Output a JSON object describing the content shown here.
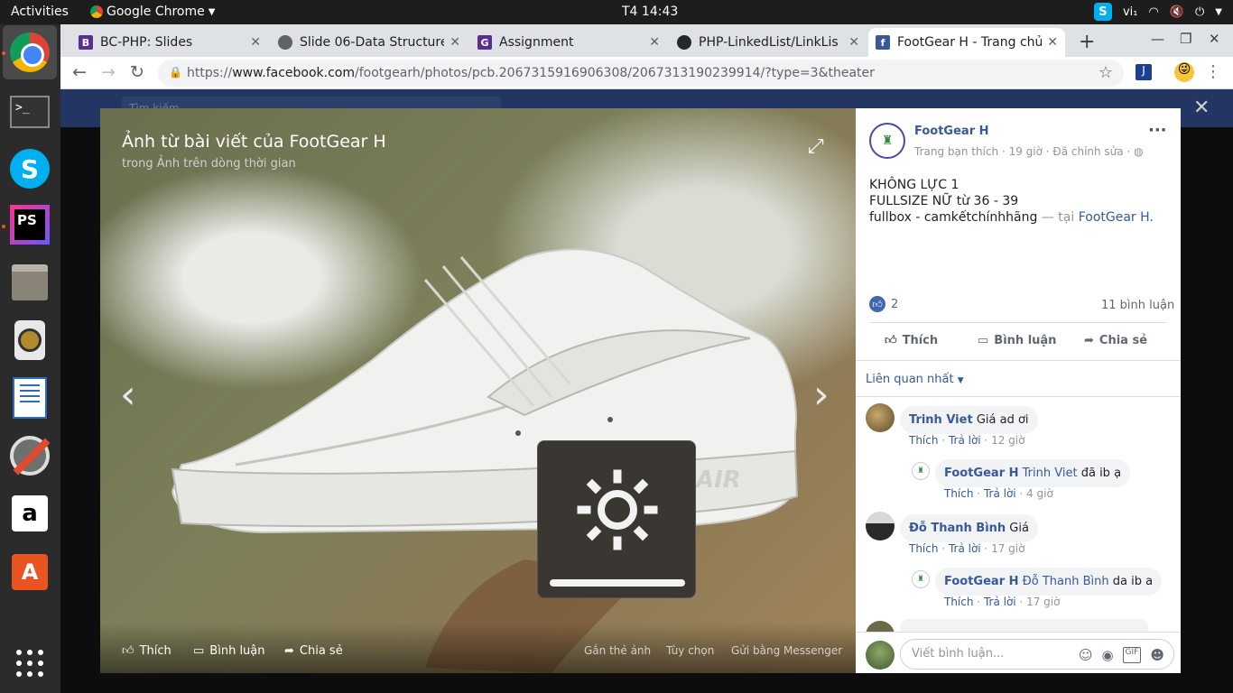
{
  "topbar": {
    "activities": "Activities",
    "app_name": "Google Chrome",
    "clock": "T4 14:43",
    "keyboard": "vi₁"
  },
  "browser": {
    "tabs": [
      {
        "title": "BC-PHP: Slides",
        "favicon_color": "#5b2d8e",
        "icon": "slides-icon"
      },
      {
        "title": "Slide 06-Data Structure",
        "favicon_color": "#5f6368",
        "icon": "globe-icon"
      },
      {
        "title": "Assignment",
        "favicon_color": "#5b2d8e",
        "icon": "assignment-icon"
      },
      {
        "title": "PHP-LinkedList/LinkLis",
        "favicon_color": "#24292e",
        "icon": "github-icon"
      },
      {
        "title": "FootGear H - Trang chủ",
        "favicon_color": "#3b5998",
        "icon": "facebook-icon"
      }
    ],
    "url_prefix": "https://",
    "url_domain": "www.facebook.com",
    "url_path": "/footgearh/photos/pcb.2067315916906308/2067313190239914/?type=3&theater"
  },
  "fb_background": {
    "search_placeholder": "Tìm kiếm"
  },
  "photo": {
    "title": "Ảnh từ bài viết của FootGear H",
    "subtitle": "trong Ảnh trên dòng thời gian",
    "actions": {
      "like": "Thích",
      "comment": "Bình luận",
      "share": "Chia sẻ"
    },
    "right_actions": {
      "tag": "Gắn thẻ ảnh",
      "options": "Tùy chọn",
      "messenger": "Gửi bằng Messenger"
    },
    "brightness_level": 1.0
  },
  "post": {
    "page_name": "FootGear H",
    "meta": "Trang bạn thích · 19 giờ · Đã chỉnh sửa ·",
    "line1": "KHÔNG LỰC 1",
    "line2": "FULLSIZE NỮ từ 36 - 39",
    "line3": "fullbox - camkếtchínhhãng",
    "at": " — tại ",
    "location": "FootGear H",
    "location_end": ".",
    "like_count": "2",
    "comment_count": "11 bình luận",
    "actions": {
      "like": "Thích",
      "comment": "Bình luận",
      "share": "Chia sẻ"
    },
    "sort_label": "Liên quan nhất"
  },
  "comments": [
    {
      "name": "Trinh Viet",
      "text": "Giá ad ơi",
      "like": "Thích",
      "reply": "Trả lời",
      "time": "12 giờ"
    },
    {
      "name": "FootGear H",
      "tag": "Trinh Viet",
      "text": "đã ib ạ",
      "like": "Thích",
      "reply": "Trả lời",
      "time": "4 giờ"
    },
    {
      "name": "Đỗ Thanh Bình",
      "text": "Giá",
      "like": "Thích",
      "reply": "Trả lời",
      "time": "17 giờ"
    },
    {
      "name": "FootGear H",
      "tag": "Đỗ Thanh Bình",
      "text": "da ib a",
      "like": "Thích",
      "reply": "Trả lời",
      "time": "17 giờ"
    }
  ],
  "composer": {
    "placeholder": "Viết bình luận..."
  }
}
